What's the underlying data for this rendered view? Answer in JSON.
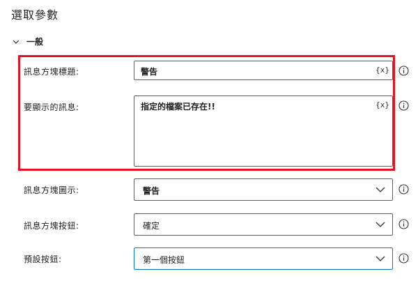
{
  "page": {
    "title": "選取參數"
  },
  "section": {
    "label": "一般"
  },
  "fields": {
    "title": {
      "label": "訊息方塊標題:",
      "value": "警告",
      "var_token": "{x}"
    },
    "message": {
      "label": "要顯示的訊息:",
      "value": "指定的檔案已存在!!",
      "var_token": "{x}"
    },
    "icon": {
      "label": "訊息方塊圖示:",
      "value": "警告"
    },
    "buttons": {
      "label": "訊息方塊按鈕:",
      "value": "確定"
    },
    "default_button": {
      "label": "預設按鈕:",
      "value": "第一個按鈕"
    }
  },
  "icons": {
    "section": "chevron-down-icon",
    "dropdown": "chevron-down-icon",
    "info": "info-icon"
  },
  "colors": {
    "highlight": "#e81123",
    "focus_border": "#0078d4",
    "field_border": "#605e5c"
  }
}
